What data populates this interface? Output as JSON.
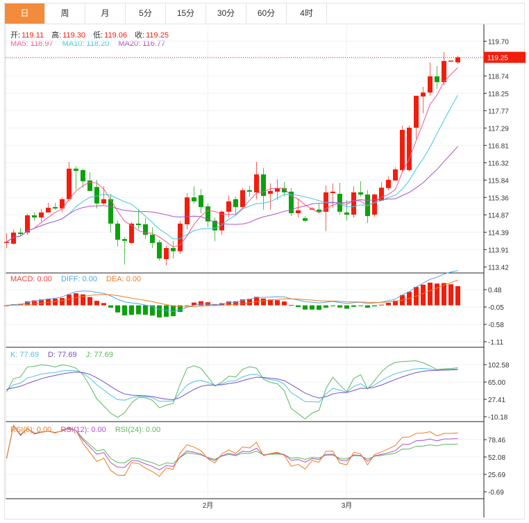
{
  "tabs": [
    "日",
    "周",
    "月",
    "5分",
    "15分",
    "30分",
    "60分",
    "4时"
  ],
  "active_tab": 0,
  "ohlc_header": {
    "open_label": "开:",
    "open": "119.11",
    "high_label": "高:",
    "high": "119.30",
    "low_label": "低:",
    "low": "119.06",
    "close_label": "收:",
    "close": "119.25"
  },
  "ma_header": {
    "ma5": "MA5: 118.97",
    "ma10": "MA10: 118.20",
    "ma20": "MA20: 116.77"
  },
  "macd_header": {
    "macd": "MACD: 0.00",
    "diff": "DIFF: 0.00",
    "dea": "DEA: 0.00"
  },
  "kdj_header": {
    "k": "K: 77.69",
    "d": "D: 77.69",
    "j": "J: 77.69"
  },
  "rsi_header": {
    "rsi6": "RSI(6): 0.00",
    "rsi12": "RSI(12): 0.00",
    "rsi24": "RSI(24): 0.00"
  },
  "price_axis": [
    "119.70",
    "118.74",
    "118.25",
    "117.77",
    "117.29",
    "116.81",
    "116.32",
    "115.84",
    "115.36",
    "114.87",
    "114.39",
    "113.91",
    "113.42"
  ],
  "current_price": "119.25",
  "macd_axis": [
    "0.48",
    "-0.05",
    "-0.58",
    "-1.11"
  ],
  "kdj_axis": [
    "102.58",
    "65.00",
    "27.41",
    "-10.18"
  ],
  "rsi_axis": [
    "78.46",
    "52.08",
    "25.69",
    "-0.69"
  ],
  "x_labels": [
    {
      "text": "2月",
      "index": 29
    },
    {
      "text": "3月",
      "index": 49
    }
  ],
  "colors": {
    "up": "#f21d0c",
    "down": "#0aa20a",
    "ma5": "#f0588c",
    "ma10": "#3ec6df",
    "ma20": "#b04fc8",
    "diff": "#4aa3ef",
    "dea": "#f27a1e",
    "k": "#4fc3dd",
    "d": "#7a4fc9",
    "j": "#5cb85c",
    "rsi6": "#f27a1e",
    "rsi12": "#b04fc8",
    "rsi24": "#5cb85c",
    "accent": "#f28c3c"
  },
  "chart_data": {
    "type": "candlestick",
    "price_range": [
      113.42,
      119.7
    ],
    "candles_ohlc": [
      [
        114.1,
        114.11,
        114.35,
        113.94
      ],
      [
        114.06,
        114.37,
        114.46,
        114.04
      ],
      [
        114.37,
        114.33,
        114.5,
        114.27
      ],
      [
        114.37,
        114.85,
        114.89,
        114.31
      ],
      [
        114.85,
        114.79,
        114.93,
        114.7
      ],
      [
        114.79,
        114.93,
        115.03,
        114.68
      ],
      [
        114.93,
        115.06,
        115.2,
        114.93
      ],
      [
        115.08,
        115.04,
        115.2,
        115.01
      ],
      [
        115.04,
        115.3,
        115.35,
        114.93
      ],
      [
        115.3,
        116.15,
        116.34,
        115.24
      ],
      [
        116.15,
        116.09,
        116.22,
        115.57
      ],
      [
        116.11,
        115.8,
        116.15,
        115.62
      ],
      [
        115.82,
        115.53,
        116.05,
        115.53
      ],
      [
        115.64,
        115.18,
        115.84,
        115.04
      ],
      [
        115.18,
        115.3,
        115.66,
        115.14
      ],
      [
        115.3,
        114.62,
        115.45,
        114.37
      ],
      [
        114.62,
        114.17,
        114.7,
        113.98
      ],
      [
        114.19,
        114.14,
        114.25,
        113.48
      ],
      [
        114.08,
        114.62,
        114.66,
        114.06
      ],
      [
        114.62,
        114.58,
        115.01,
        114.46
      ],
      [
        114.6,
        114.31,
        114.77,
        114.19
      ],
      [
        114.31,
        114.08,
        114.52,
        113.94
      ],
      [
        114.1,
        113.65,
        114.17,
        113.59
      ],
      [
        113.63,
        113.94,
        114.0,
        113.46
      ],
      [
        113.94,
        113.85,
        114.13,
        113.65
      ],
      [
        113.85,
        114.62,
        114.7,
        113.77
      ],
      [
        114.6,
        115.35,
        115.47,
        114.46
      ],
      [
        115.35,
        115.24,
        115.66,
        115.18
      ],
      [
        115.41,
        115.08,
        115.58,
        114.91
      ],
      [
        115.1,
        114.68,
        115.18,
        114.52
      ],
      [
        114.7,
        114.43,
        114.79,
        114.13
      ],
      [
        114.43,
        114.95,
        114.99,
        114.31
      ],
      [
        114.95,
        115.24,
        115.41,
        114.79
      ],
      [
        115.3,
        115.08,
        115.37,
        114.89
      ],
      [
        115.08,
        115.55,
        115.62,
        115.03
      ],
      [
        115.55,
        115.51,
        115.66,
        115.37
      ],
      [
        115.49,
        115.99,
        116.34,
        115.3
      ],
      [
        115.99,
        115.39,
        116.17,
        115.01
      ],
      [
        115.45,
        115.53,
        115.74,
        115.01
      ],
      [
        115.51,
        115.61,
        115.86,
        115.28
      ],
      [
        115.61,
        115.49,
        115.78,
        115.37
      ],
      [
        115.51,
        114.91,
        115.61,
        114.83
      ],
      [
        114.91,
        114.99,
        115.3,
        114.79
      ],
      [
        114.77,
        114.7,
        114.83,
        114.66
      ],
      [
        115.01,
        115.04,
        115.08,
        114.99
      ],
      [
        115.01,
        114.95,
        115.18,
        114.93
      ],
      [
        114.95,
        115.49,
        115.68,
        114.41
      ],
      [
        115.47,
        115.51,
        115.74,
        115.06
      ],
      [
        115.45,
        114.95,
        115.76,
        114.87
      ],
      [
        114.93,
        114.87,
        115.28,
        114.7
      ],
      [
        114.87,
        115.49,
        115.66,
        114.79
      ],
      [
        115.49,
        115.43,
        115.8,
        115.37
      ],
      [
        115.43,
        114.83,
        115.55,
        114.64
      ],
      [
        114.87,
        115.43,
        115.45,
        114.81
      ],
      [
        115.26,
        115.62,
        115.78,
        115.26
      ],
      [
        115.61,
        115.84,
        115.93,
        115.55
      ],
      [
        115.82,
        116.13,
        116.19,
        115.82
      ],
      [
        116.11,
        117.23,
        117.35,
        116.07
      ],
      [
        116.11,
        117.29,
        117.35,
        116.07
      ],
      [
        117.29,
        118.18,
        118.18,
        116.98
      ],
      [
        118.16,
        118.27,
        118.43,
        117.69
      ],
      [
        118.27,
        118.72,
        119.11,
        118.18
      ],
      [
        118.72,
        118.56,
        119.01,
        118.37
      ],
      [
        118.56,
        119.15,
        119.4,
        118.47
      ],
      [
        119.15,
        119.16,
        119.16,
        119.15
      ],
      [
        119.11,
        119.25,
        119.3,
        119.06
      ]
    ],
    "indicators": [
      "MA5",
      "MA10",
      "MA20",
      "MACD",
      "KDJ",
      "RSI"
    ]
  }
}
